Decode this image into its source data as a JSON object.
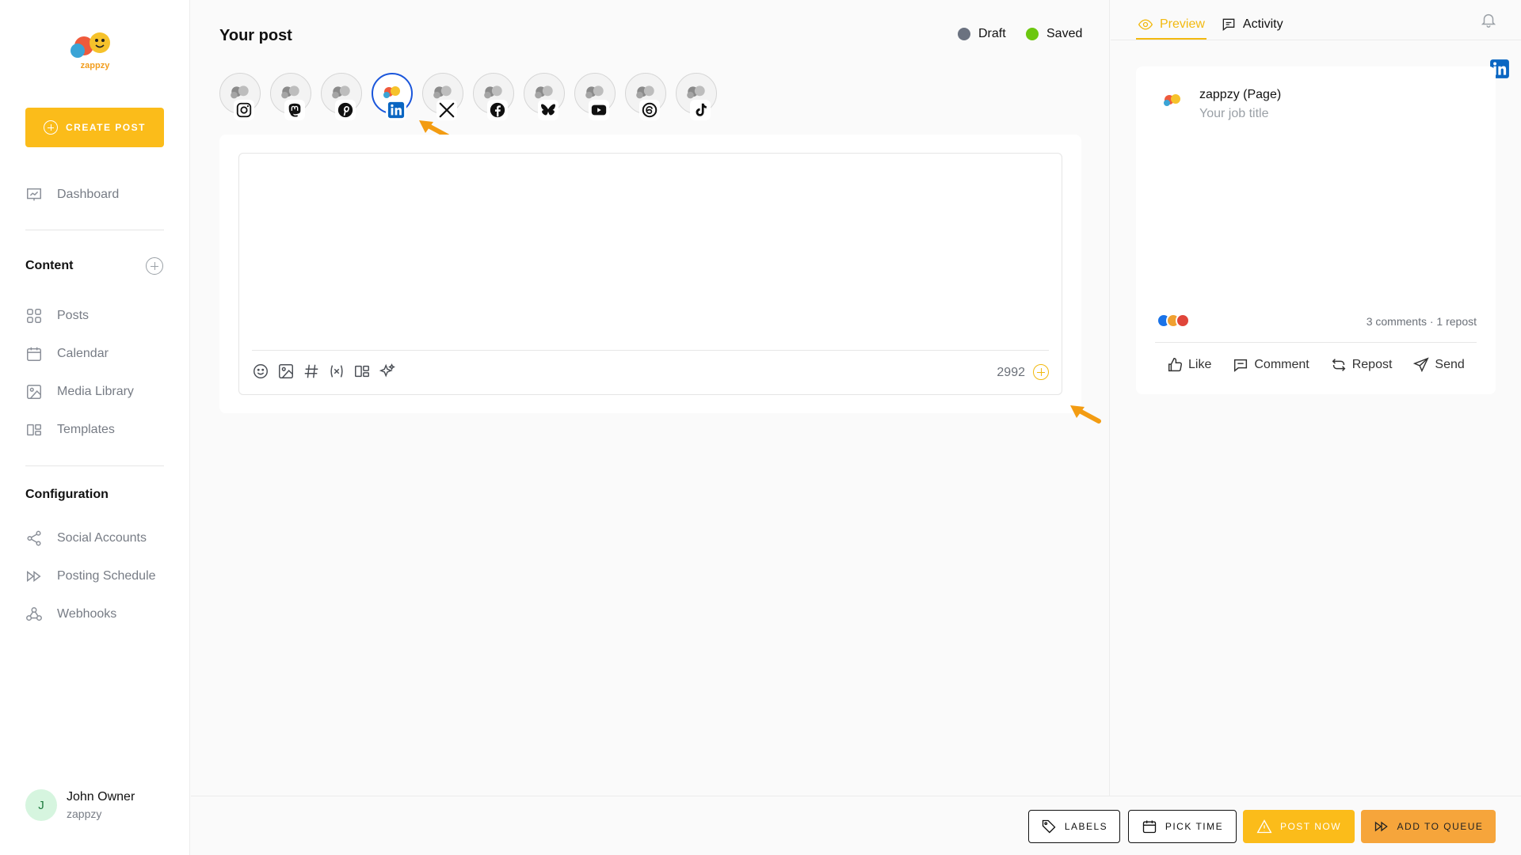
{
  "sidebar": {
    "logo_text": "zappzy",
    "create_post": "CREATE POST",
    "dashboard": "Dashboard",
    "content_title": "Content",
    "content_items": [
      "Posts",
      "Calendar",
      "Media Library",
      "Templates"
    ],
    "config_title": "Configuration",
    "config_items": [
      "Social Accounts",
      "Posting Schedule",
      "Webhooks"
    ],
    "user": {
      "initial": "J",
      "name": "John Owner",
      "org": "zappzy"
    }
  },
  "main": {
    "title": "Your post",
    "status": {
      "draft": "Draft",
      "saved": "Saved",
      "draft_color": "#6b7280",
      "saved_color": "#6cc70f"
    },
    "accounts": [
      {
        "network": "instagram-icon",
        "selected": false
      },
      {
        "network": "mastodon-icon",
        "selected": false
      },
      {
        "network": "pinterest-icon",
        "selected": false
      },
      {
        "network": "linkedin-icon",
        "selected": true
      },
      {
        "network": "x-icon",
        "selected": false
      },
      {
        "network": "facebook-icon",
        "selected": false
      },
      {
        "network": "bluesky-icon",
        "selected": false
      },
      {
        "network": "youtube-icon",
        "selected": false
      },
      {
        "network": "threads-icon",
        "selected": false
      },
      {
        "network": "tiktok-icon",
        "selected": false
      }
    ],
    "char_count": "2992",
    "accent_color": "#fbbc1a"
  },
  "right": {
    "tabs": [
      "Preview",
      "Activity"
    ],
    "preview": {
      "name": "zappzy (Page)",
      "job": "Your job title",
      "counts": "3 comments · 1 repost",
      "actions": [
        "Like",
        "Comment",
        "Repost",
        "Send"
      ]
    }
  },
  "footer": {
    "labels": "LABELS",
    "pick_time": "PICK TIME",
    "post_now": "POST NOW",
    "add_to_queue": "ADD TO QUEUE"
  }
}
